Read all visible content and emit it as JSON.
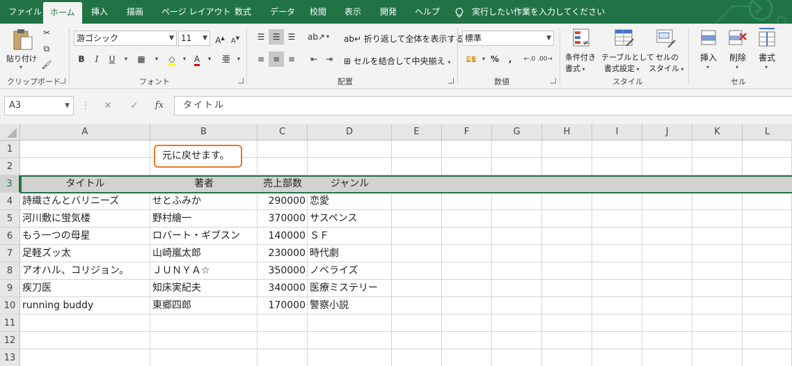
{
  "tabs": [
    {
      "label": "ファイル",
      "active": false
    },
    {
      "label": "ホーム",
      "active": true
    },
    {
      "label": "挿入",
      "active": false
    },
    {
      "label": "描画",
      "active": false
    },
    {
      "label": "ページ レイアウト",
      "active": false
    },
    {
      "label": "数式",
      "active": false
    },
    {
      "label": "データ",
      "active": false
    },
    {
      "label": "校閲",
      "active": false
    },
    {
      "label": "表示",
      "active": false
    },
    {
      "label": "開発",
      "active": false
    },
    {
      "label": "ヘルプ",
      "active": false
    }
  ],
  "tell_me": "実行したい作業を入力してください",
  "ribbon": {
    "clipboard": {
      "paste": "貼り付け",
      "label": "クリップボード"
    },
    "font": {
      "name": "游ゴシック",
      "size": "11",
      "label": "フォント"
    },
    "alignment": {
      "wrap_text": "折り返して全体を表示する",
      "merge_center": "セルを結合して中央揃え",
      "label": "配置"
    },
    "number": {
      "format": "標準",
      "label": "数値"
    },
    "styles": {
      "conditional_line1": "条件付き",
      "conditional_line2": "書式",
      "table_line1": "テーブルとして",
      "table_line2": "書式設定",
      "cell_line1": "セルの",
      "cell_line2": "スタイル",
      "label": "スタイル"
    },
    "cells": {
      "insert": "挿入",
      "delete": "削除",
      "format": "書式",
      "label": "セル"
    }
  },
  "formula_bar": {
    "name_box": "A3",
    "content": "タイトル"
  },
  "columns": [
    "A",
    "B",
    "C",
    "D",
    "E",
    "F",
    "G",
    "H",
    "I",
    "J",
    "K",
    "L"
  ],
  "rows": [
    "1",
    "2",
    "3",
    "4",
    "5",
    "6",
    "7",
    "8",
    "9",
    "10",
    "11",
    "12",
    "13"
  ],
  "callout": "元に戻せます。",
  "table": {
    "headers": [
      "タイトル",
      "著者",
      "売上部数",
      "ジャンル"
    ],
    "rows": [
      [
        "詩織さんとバリニーズ",
        "せとふみか",
        "290000",
        "恋愛"
      ],
      [
        "河川敷に蛍気楼",
        "野村繪一",
        "370000",
        "サスペンス"
      ],
      [
        "もう一つの母星",
        "ロバート・ギブスン",
        "140000",
        "ＳＦ"
      ],
      [
        "足軽ズッ太",
        "山崎嵐太郎",
        "230000",
        "時代劇"
      ],
      [
        "アオハル、コリジョン。",
        "ＪＵＮＹＡ☆",
        "350000",
        "ノベライズ"
      ],
      [
        "疾刀医",
        "知床実紀夫",
        "340000",
        "医療ミステリー"
      ],
      [
        "running buddy",
        "東郷四郎",
        "170000",
        "警察小説"
      ]
    ]
  },
  "colors": {
    "accent": "#217346",
    "callout_border": "#e87722"
  }
}
